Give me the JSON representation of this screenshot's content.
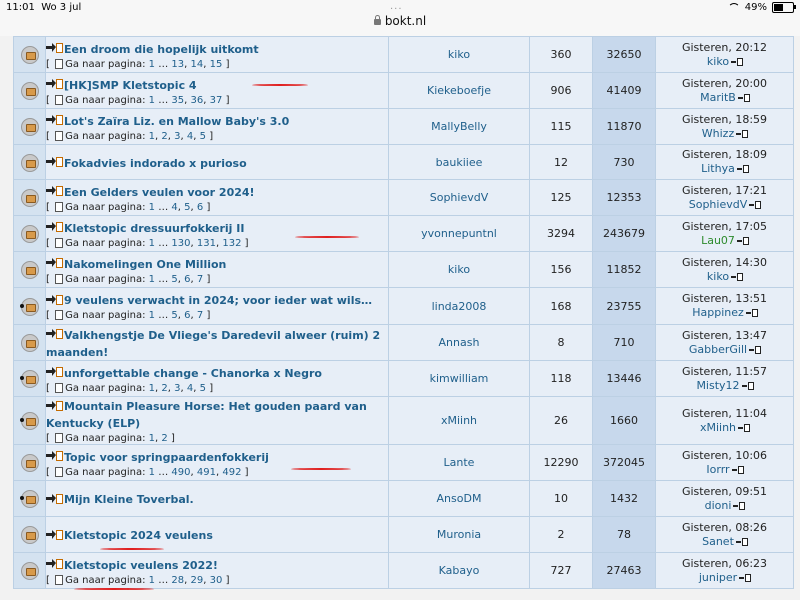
{
  "status_bar": {
    "time": "11:01",
    "date": "Wo 3 jul",
    "url": "bokt.nl",
    "battery": "49%"
  },
  "labels": {
    "goto": "Ga naar pagina:"
  },
  "topics": [
    {
      "title": "Een droom die hopelijk uitkomt",
      "pages": [
        "1",
        "…",
        "13",
        "14",
        "15"
      ],
      "author": "kiko",
      "replies": "360",
      "views": "32650",
      "last_time": "Gisteren, 20:12",
      "last_user": "kiko",
      "dot": false
    },
    {
      "title": "[HK]SMP Kletstopic 4",
      "pages": [
        "1",
        "…",
        "35",
        "36",
        "37"
      ],
      "author": "Kiekeboefje",
      "replies": "906",
      "views": "41409",
      "last_time": "Gisteren, 20:00",
      "last_user": "MaritB",
      "dot": false
    },
    {
      "title": "Lot's Zaïra Liz. en Mallow Baby's 3.0",
      "pages": [
        "1",
        "2",
        "3",
        "4",
        "5"
      ],
      "author": "MallyBelly",
      "replies": "115",
      "views": "11870",
      "last_time": "Gisteren, 18:59",
      "last_user": "Whizz",
      "dot": false
    },
    {
      "title": "Fokadvies indorado x purioso",
      "pages": [],
      "author": "baukiiee",
      "replies": "12",
      "views": "730",
      "last_time": "Gisteren, 18:09",
      "last_user": "Lithya",
      "dot": false
    },
    {
      "title": "Een Gelders veulen voor 2024!",
      "pages": [
        "1",
        "…",
        "4",
        "5",
        "6"
      ],
      "author": "SophievdV",
      "replies": "125",
      "views": "12353",
      "last_time": "Gisteren, 17:21",
      "last_user": "SophievdV",
      "dot": false
    },
    {
      "title": "Kletstopic dressuurfokkerij II",
      "pages": [
        "1",
        "…",
        "130",
        "131",
        "132"
      ],
      "author": "yvonnepuntnl",
      "replies": "3294",
      "views": "243679",
      "last_time": "Gisteren, 17:05",
      "last_user": "Lau07",
      "dot": false,
      "green": true
    },
    {
      "title": "Nakomelingen One Million",
      "pages": [
        "1",
        "…",
        "5",
        "6",
        "7"
      ],
      "author": "kiko",
      "replies": "156",
      "views": "11852",
      "last_time": "Gisteren, 14:30",
      "last_user": "kiko",
      "dot": false
    },
    {
      "title": "9 veulens verwacht in 2024; voor ieder wat wils…",
      "pages": [
        "1",
        "…",
        "5",
        "6",
        "7"
      ],
      "author": "linda2008",
      "replies": "168",
      "views": "23755",
      "last_time": "Gisteren, 13:51",
      "last_user": "Happinez",
      "dot": true
    },
    {
      "title": "Valkhengstje De Vliege's Daredevil alweer (ruim) 2 maanden!",
      "pages": [],
      "author": "Annash",
      "replies": "8",
      "views": "710",
      "last_time": "Gisteren, 13:47",
      "last_user": "GabberGill",
      "dot": false
    },
    {
      "title": "unforgettable change - Chanorka x Negro",
      "pages": [
        "1",
        "2",
        "3",
        "4",
        "5"
      ],
      "author": "kimwilliam",
      "replies": "118",
      "views": "13446",
      "last_time": "Gisteren, 11:57",
      "last_user": "Misty12",
      "dot": true
    },
    {
      "title": "Mountain Pleasure Horse: Het gouden paard van Kentucky (ELP)",
      "pages": [
        "1",
        "2"
      ],
      "author": "xMiinh",
      "replies": "26",
      "views": "1660",
      "last_time": "Gisteren, 11:04",
      "last_user": "xMiinh",
      "dot": true
    },
    {
      "title": "Topic voor springpaardenfokkerij",
      "pages": [
        "1",
        "…",
        "490",
        "491",
        "492"
      ],
      "author": "Lante",
      "replies": "12290",
      "views": "372045",
      "last_time": "Gisteren, 10:06",
      "last_user": "Iorrr",
      "dot": false
    },
    {
      "title": "Mijn Kleine Toverbal.",
      "pages": [],
      "author": "AnsoDM",
      "replies": "10",
      "views": "1432",
      "last_time": "Gisteren, 09:51",
      "last_user": "dioni",
      "dot": true
    },
    {
      "title": "Kletstopic 2024 veulens",
      "pages": [],
      "author": "Muronia",
      "replies": "2",
      "views": "78",
      "last_time": "Gisteren, 08:26",
      "last_user": "Sanet",
      "dot": false
    },
    {
      "title": "Kletstopic veulens 2022!",
      "pages": [
        "1",
        "…",
        "28",
        "29",
        "30"
      ],
      "author": "Kabayo",
      "replies": "727",
      "views": "27463",
      "last_time": "Gisteren, 06:23",
      "last_user": "juniper",
      "dot": false
    }
  ],
  "colors": {
    "link": "#1f5f8b",
    "row_bg": "#e7eef7",
    "views_bg": "#c7d8ec",
    "icon_bg": "#d4e2f0",
    "annotation": "#e02020"
  }
}
